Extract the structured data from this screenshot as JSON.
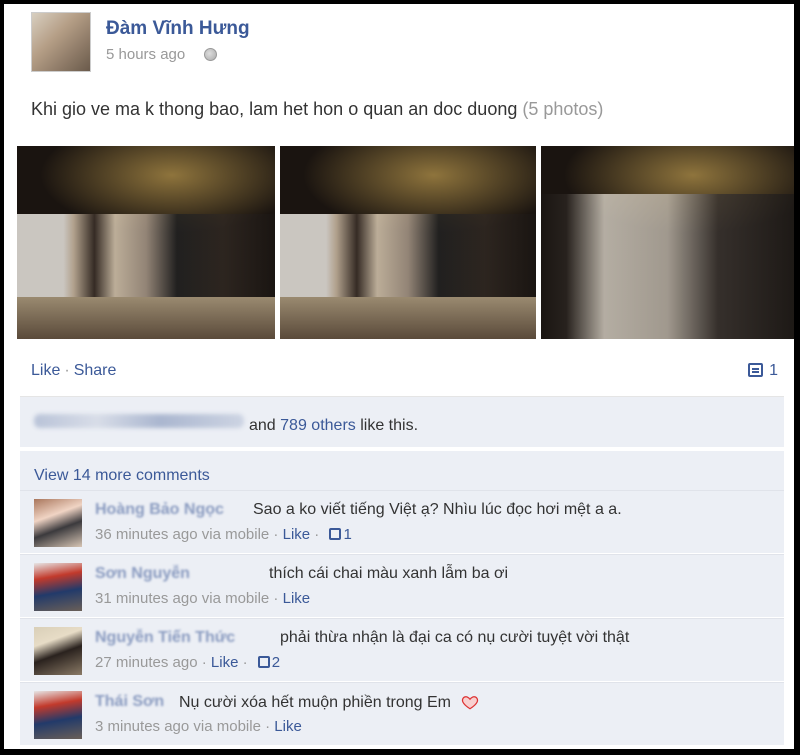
{
  "post": {
    "author": "Đàm Vĩnh Hưng",
    "time": "5 hours ago",
    "message": "Khi gio ve ma k thong bao, lam het hon o quan an doc duong",
    "photo_count": "(5 photos)"
  },
  "actions": {
    "like": "Like",
    "separator": "·",
    "share": "Share",
    "comment_count": "1"
  },
  "likes": {
    "text_suffix": "and",
    "others": "789 others",
    "like_this": "like this."
  },
  "comments_block": {
    "view_more": "View 14 more comments",
    "items": [
      {
        "name": "Hoàng Bảo Ngọc",
        "text": "Sao a ko viết tiếng Việt ạ? Nhìu lúc đọc hơi mệt a a.",
        "time": "36 minutes ago via mobile",
        "like": "Like",
        "likes": "1"
      },
      {
        "name": "Sơn Nguyễn",
        "text": "thích cái chai màu xanh lẫm ba ơi",
        "time": "31 minutes ago via mobile",
        "like": "Like",
        "likes": ""
      },
      {
        "name": "Nguyễn Tiến Thức",
        "text": "phải thừa nhận là đại ca có nụ cười tuyệt vời thật",
        "time": "27 minutes ago",
        "like": "Like",
        "likes": "2"
      },
      {
        "name": "Thái Sơn",
        "text": "Nụ cười xóa hết muộn phiền trong Em",
        "time": "3 minutes ago via mobile",
        "like": "Like",
        "likes": ""
      }
    ]
  },
  "colors": {
    "link": "#3b5998",
    "meta": "#999999",
    "feedback_bg": "#eceff5"
  }
}
